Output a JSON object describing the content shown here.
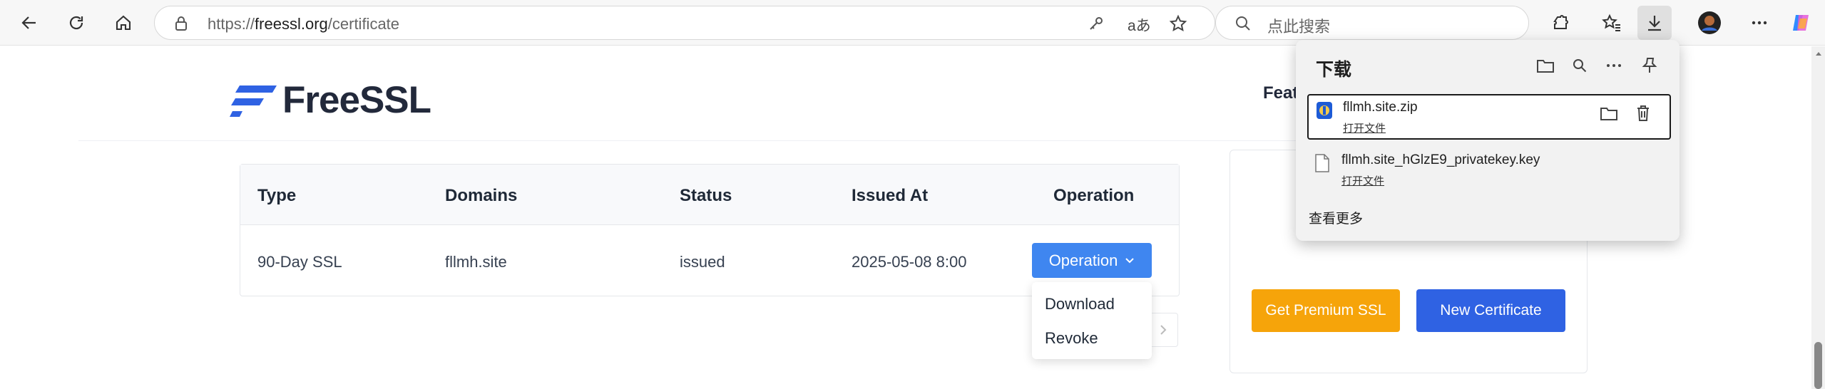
{
  "browser": {
    "url_prefix": "https://",
    "url_domain": "freessl.org",
    "url_path": "/certificate",
    "search_placeholder": "点此搜索",
    "translate_label": "aあ"
  },
  "site": {
    "logo_text": "FreeSSL",
    "nav_partial": "Feat",
    "brand_color": "#2f62e3"
  },
  "table": {
    "headers": [
      "Type",
      "Domains",
      "Status",
      "Issued At",
      "Operation"
    ],
    "row": {
      "type": "90-Day SSL",
      "domain": "fllmh.site",
      "status": "issued",
      "issued_at": "2025-05-08 8:00",
      "operation_label": "Operation"
    }
  },
  "operation_menu": {
    "items": [
      "Download",
      "Revoke"
    ]
  },
  "sidebar": {
    "premium_button": "Get Premium SSL",
    "new_button": "New Certificate"
  },
  "downloads": {
    "title": "下载",
    "items": [
      {
        "name": "fllmh.site.zip",
        "action": "打开文件"
      },
      {
        "name": "fllmh.site_hGlzE9_privatekey.key",
        "action": "打开文件"
      }
    ],
    "see_more": "查看更多"
  }
}
